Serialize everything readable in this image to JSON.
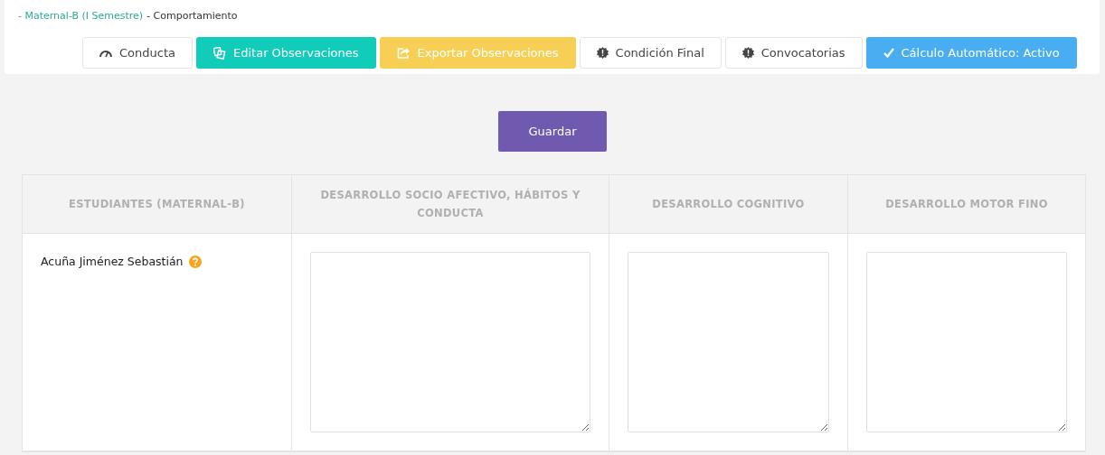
{
  "breadcrumb": {
    "link": "- Maternal-B (I Semestre)",
    "current": "- Comportamiento"
  },
  "toolbar": [
    {
      "label": "Conducta",
      "kind": "default"
    },
    {
      "label": "Editar Observaciones",
      "kind": "teal"
    },
    {
      "label": "Exportar Observaciones",
      "kind": "yellow"
    },
    {
      "label": "Condición Final",
      "kind": "default"
    },
    {
      "label": "Convocatorias",
      "kind": "default"
    },
    {
      "label": "Cálculo Automático: Activo",
      "kind": "blue"
    }
  ],
  "save_button": "Guardar",
  "table": {
    "columns": [
      "ESTUDIANTES (MATERNAL-B)",
      "DESARROLLO SOCIO AFECTIVO, HÁBITOS Y CONDUCTA",
      "DESARROLLO COGNITIVO",
      "DESARROLLO MOTOR FINO"
    ],
    "rows": [
      {
        "student": "Acuña Jiménez Sebastián"
      }
    ]
  }
}
